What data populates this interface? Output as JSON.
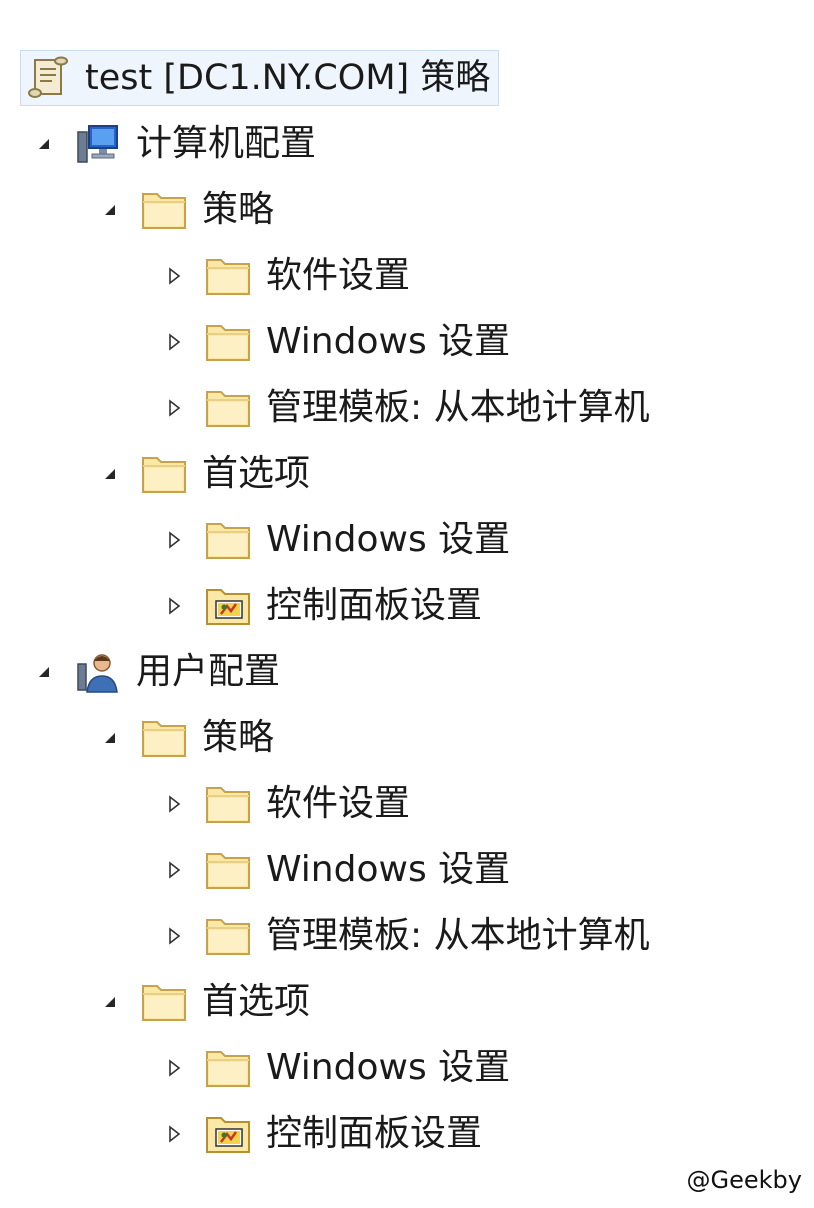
{
  "tree": {
    "root": {
      "label": "test [DC1.NY.COM] 策略",
      "icon": "policy-scroll-icon",
      "selected": true
    },
    "computer_config": {
      "label": "计算机配置",
      "icon": "computer-icon",
      "expanded": true,
      "policies": {
        "label": "策略",
        "expanded": true,
        "children": [
          {
            "label": "软件设置"
          },
          {
            "label": "Windows 设置"
          },
          {
            "label": "管理模板: 从本地计算机"
          }
        ]
      },
      "preferences": {
        "label": "首选项",
        "expanded": true,
        "children": [
          {
            "label": "Windows 设置"
          },
          {
            "label": "控制面板设置",
            "icon": "control-panel-folder-icon"
          }
        ]
      }
    },
    "user_config": {
      "label": "用户配置",
      "icon": "user-icon",
      "expanded": true,
      "policies": {
        "label": "策略",
        "expanded": true,
        "children": [
          {
            "label": "软件设置"
          },
          {
            "label": "Windows 设置"
          },
          {
            "label": "管理模板: 从本地计算机"
          }
        ]
      },
      "preferences": {
        "label": "首选项",
        "expanded": true,
        "children": [
          {
            "label": "Windows 设置"
          },
          {
            "label": "控制面板设置",
            "icon": "control-panel-folder-icon"
          }
        ]
      }
    }
  },
  "watermark": "@Geekby",
  "colors": {
    "selection_bg": "#eef5fc",
    "selection_border": "#c9ddf2",
    "folder_fill": "#fbe7a6",
    "folder_stroke": "#c8a24a",
    "text": "#1a1a1a"
  }
}
